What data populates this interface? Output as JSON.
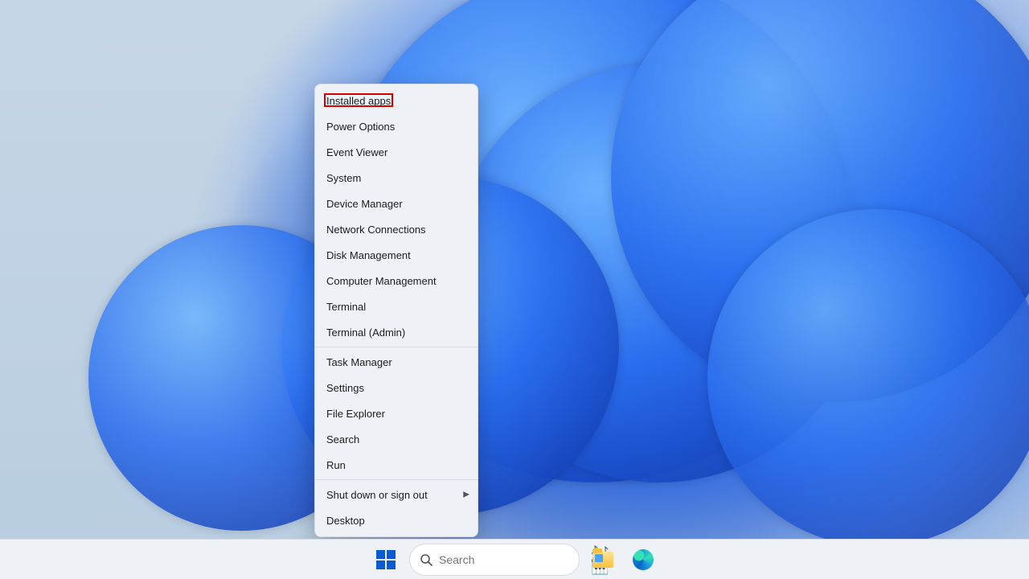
{
  "contextMenu": {
    "highlightIndex": 0,
    "groups": [
      [
        {
          "label": "Installed apps",
          "submenu": false
        },
        {
          "label": "Power Options",
          "submenu": false
        },
        {
          "label": "Event Viewer",
          "submenu": false
        },
        {
          "label": "System",
          "submenu": false
        },
        {
          "label": "Device Manager",
          "submenu": false
        },
        {
          "label": "Network Connections",
          "submenu": false
        },
        {
          "label": "Disk Management",
          "submenu": false
        },
        {
          "label": "Computer Management",
          "submenu": false
        },
        {
          "label": "Terminal",
          "submenu": false
        },
        {
          "label": "Terminal (Admin)",
          "submenu": false
        }
      ],
      [
        {
          "label": "Task Manager",
          "submenu": false
        },
        {
          "label": "Settings",
          "submenu": false
        },
        {
          "label": "File Explorer",
          "submenu": false
        },
        {
          "label": "Search",
          "submenu": false
        },
        {
          "label": "Run",
          "submenu": false
        }
      ],
      [
        {
          "label": "Shut down or sign out",
          "submenu": true
        },
        {
          "label": "Desktop",
          "submenu": false
        }
      ]
    ]
  },
  "taskbar": {
    "search": {
      "placeholder": "Search",
      "decorGlyph": "🎶🎹"
    },
    "icons": {
      "start": "start-icon",
      "explorer": "file-explorer-icon",
      "edge": "edge-icon"
    }
  }
}
